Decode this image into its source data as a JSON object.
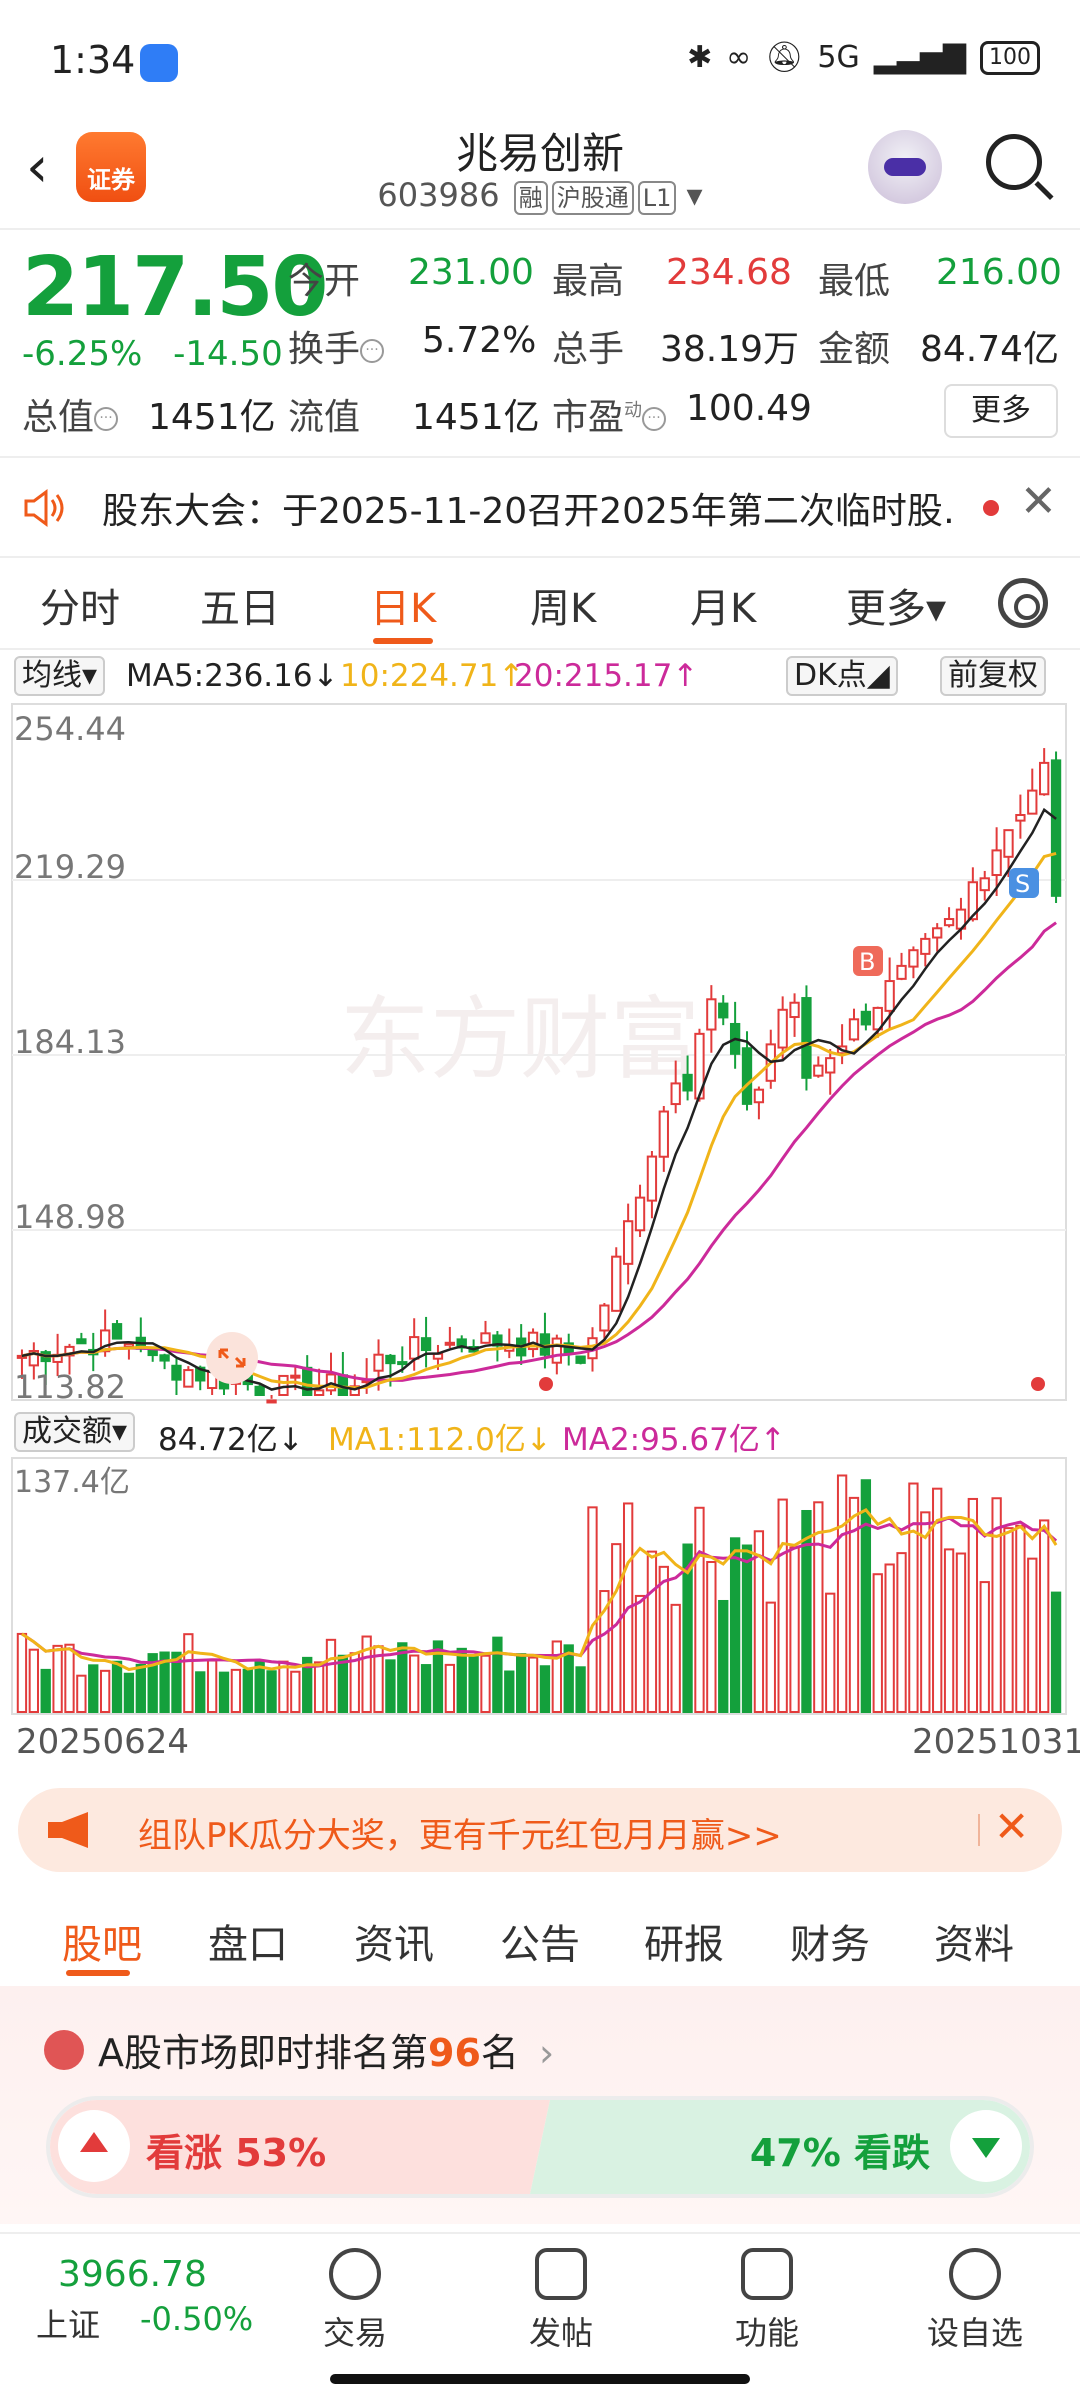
{
  "status": {
    "time": "1:34",
    "battery": "100",
    "net": "5G"
  },
  "header": {
    "back": "‹",
    "logo_text": "证券",
    "name": "兆易创新",
    "code": "603986",
    "tags": [
      "融",
      "沪股通",
      "L1"
    ]
  },
  "quote": {
    "price": "217.50",
    "pct": "-6.25%",
    "chg": "-14.50",
    "open_label": "今开",
    "open": "231.00",
    "high_label": "最高",
    "high": "234.68",
    "low_label": "最低",
    "low": "216.00",
    "turnover_label": "换手",
    "turnover": "5.72%",
    "volume_label": "总手",
    "volume": "38.19万",
    "amount_label": "金额",
    "amount": "84.74亿",
    "mktcap_label": "总值",
    "mktcap": "1451亿",
    "float_label": "流值",
    "float": "1451亿",
    "pe_label": "市盈",
    "pe_sup": "动",
    "pe": "100.49",
    "more": "更多"
  },
  "notice": {
    "text": "股东大会：于2025-11-20召开2025年第二次临时股…",
    "close": "✕"
  },
  "tabs": [
    "分时",
    "五日",
    "日K",
    "周K",
    "月K",
    "更多▾"
  ],
  "active_tab": "日K",
  "ma_legend": {
    "selector": "均线▾",
    "ma5": "MA5:236.16↓",
    "ma10": "10:224.71↑",
    "ma20": "20:215.17↑",
    "dk": "DK点◢",
    "adjust": "前复权"
  },
  "vol_legend": {
    "selector": "成交额▾",
    "value": "84.72亿↓",
    "ma1": "MA1:112.0亿↓",
    "ma2": "MA2:95.67亿↑"
  },
  "colors": {
    "up": "#e23b3b",
    "down": "#14a03c",
    "ma5": "#222222",
    "ma10": "#f0b419",
    "ma20": "#cc2a9a",
    "accent": "#ef5a1a"
  },
  "chart_data": {
    "type": "candlestick",
    "y_ticks": [
      "254.44",
      "219.29",
      "184.13",
      "148.98",
      "113.82"
    ],
    "ylim": [
      113.82,
      254.44
    ],
    "vol_tick": "137.4亿",
    "x_start": "20250624",
    "x_end": "20251031",
    "marks": {
      "B": "B",
      "S": "S"
    }
  },
  "promo": {
    "text": "组队PK瓜分大奖，更有千元红包月月赢>>",
    "close": "✕"
  },
  "tabs2": [
    "股吧",
    "盘口",
    "资讯",
    "公告",
    "研报",
    "财务",
    "资料"
  ],
  "rank": {
    "prefix": "A股市场即时排名第",
    "num": "96",
    "suffix": "名",
    "arrow": "›"
  },
  "vote": {
    "up": "看涨 53%",
    "down": "47% 看跌",
    "up_pct": 53
  },
  "bottom": {
    "index_val": "3966.78",
    "index_name": "上证",
    "index_chg": "-0.50%",
    "items": [
      {
        "icon": "trade-icon",
        "label": "交易"
      },
      {
        "icon": "post-icon",
        "label": "发帖"
      },
      {
        "icon": "function-icon",
        "label": "功能"
      },
      {
        "icon": "watchlist-icon",
        "label": "设自选"
      }
    ]
  }
}
